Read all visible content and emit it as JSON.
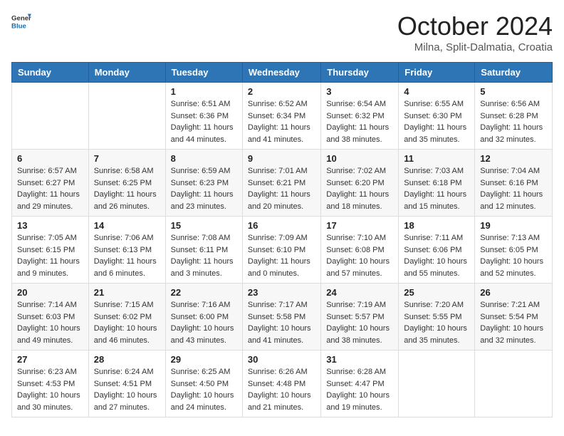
{
  "logo": {
    "general": "General",
    "blue": "Blue"
  },
  "header": {
    "month": "October 2024",
    "location": "Milna, Split-Dalmatia, Croatia"
  },
  "weekdays": [
    "Sunday",
    "Monday",
    "Tuesday",
    "Wednesday",
    "Thursday",
    "Friday",
    "Saturday"
  ],
  "weeks": [
    [
      {
        "day": "",
        "sunrise": "",
        "sunset": "",
        "daylight": ""
      },
      {
        "day": "",
        "sunrise": "",
        "sunset": "",
        "daylight": ""
      },
      {
        "day": "1",
        "sunrise": "Sunrise: 6:51 AM",
        "sunset": "Sunset: 6:36 PM",
        "daylight": "Daylight: 11 hours and 44 minutes."
      },
      {
        "day": "2",
        "sunrise": "Sunrise: 6:52 AM",
        "sunset": "Sunset: 6:34 PM",
        "daylight": "Daylight: 11 hours and 41 minutes."
      },
      {
        "day": "3",
        "sunrise": "Sunrise: 6:54 AM",
        "sunset": "Sunset: 6:32 PM",
        "daylight": "Daylight: 11 hours and 38 minutes."
      },
      {
        "day": "4",
        "sunrise": "Sunrise: 6:55 AM",
        "sunset": "Sunset: 6:30 PM",
        "daylight": "Daylight: 11 hours and 35 minutes."
      },
      {
        "day": "5",
        "sunrise": "Sunrise: 6:56 AM",
        "sunset": "Sunset: 6:28 PM",
        "daylight": "Daylight: 11 hours and 32 minutes."
      }
    ],
    [
      {
        "day": "6",
        "sunrise": "Sunrise: 6:57 AM",
        "sunset": "Sunset: 6:27 PM",
        "daylight": "Daylight: 11 hours and 29 minutes."
      },
      {
        "day": "7",
        "sunrise": "Sunrise: 6:58 AM",
        "sunset": "Sunset: 6:25 PM",
        "daylight": "Daylight: 11 hours and 26 minutes."
      },
      {
        "day": "8",
        "sunrise": "Sunrise: 6:59 AM",
        "sunset": "Sunset: 6:23 PM",
        "daylight": "Daylight: 11 hours and 23 minutes."
      },
      {
        "day": "9",
        "sunrise": "Sunrise: 7:01 AM",
        "sunset": "Sunset: 6:21 PM",
        "daylight": "Daylight: 11 hours and 20 minutes."
      },
      {
        "day": "10",
        "sunrise": "Sunrise: 7:02 AM",
        "sunset": "Sunset: 6:20 PM",
        "daylight": "Daylight: 11 hours and 18 minutes."
      },
      {
        "day": "11",
        "sunrise": "Sunrise: 7:03 AM",
        "sunset": "Sunset: 6:18 PM",
        "daylight": "Daylight: 11 hours and 15 minutes."
      },
      {
        "day": "12",
        "sunrise": "Sunrise: 7:04 AM",
        "sunset": "Sunset: 6:16 PM",
        "daylight": "Daylight: 11 hours and 12 minutes."
      }
    ],
    [
      {
        "day": "13",
        "sunrise": "Sunrise: 7:05 AM",
        "sunset": "Sunset: 6:15 PM",
        "daylight": "Daylight: 11 hours and 9 minutes."
      },
      {
        "day": "14",
        "sunrise": "Sunrise: 7:06 AM",
        "sunset": "Sunset: 6:13 PM",
        "daylight": "Daylight: 11 hours and 6 minutes."
      },
      {
        "day": "15",
        "sunrise": "Sunrise: 7:08 AM",
        "sunset": "Sunset: 6:11 PM",
        "daylight": "Daylight: 11 hours and 3 minutes."
      },
      {
        "day": "16",
        "sunrise": "Sunrise: 7:09 AM",
        "sunset": "Sunset: 6:10 PM",
        "daylight": "Daylight: 11 hours and 0 minutes."
      },
      {
        "day": "17",
        "sunrise": "Sunrise: 7:10 AM",
        "sunset": "Sunset: 6:08 PM",
        "daylight": "Daylight: 10 hours and 57 minutes."
      },
      {
        "day": "18",
        "sunrise": "Sunrise: 7:11 AM",
        "sunset": "Sunset: 6:06 PM",
        "daylight": "Daylight: 10 hours and 55 minutes."
      },
      {
        "day": "19",
        "sunrise": "Sunrise: 7:13 AM",
        "sunset": "Sunset: 6:05 PM",
        "daylight": "Daylight: 10 hours and 52 minutes."
      }
    ],
    [
      {
        "day": "20",
        "sunrise": "Sunrise: 7:14 AM",
        "sunset": "Sunset: 6:03 PM",
        "daylight": "Daylight: 10 hours and 49 minutes."
      },
      {
        "day": "21",
        "sunrise": "Sunrise: 7:15 AM",
        "sunset": "Sunset: 6:02 PM",
        "daylight": "Daylight: 10 hours and 46 minutes."
      },
      {
        "day": "22",
        "sunrise": "Sunrise: 7:16 AM",
        "sunset": "Sunset: 6:00 PM",
        "daylight": "Daylight: 10 hours and 43 minutes."
      },
      {
        "day": "23",
        "sunrise": "Sunrise: 7:17 AM",
        "sunset": "Sunset: 5:58 PM",
        "daylight": "Daylight: 10 hours and 41 minutes."
      },
      {
        "day": "24",
        "sunrise": "Sunrise: 7:19 AM",
        "sunset": "Sunset: 5:57 PM",
        "daylight": "Daylight: 10 hours and 38 minutes."
      },
      {
        "day": "25",
        "sunrise": "Sunrise: 7:20 AM",
        "sunset": "Sunset: 5:55 PM",
        "daylight": "Daylight: 10 hours and 35 minutes."
      },
      {
        "day": "26",
        "sunrise": "Sunrise: 7:21 AM",
        "sunset": "Sunset: 5:54 PM",
        "daylight": "Daylight: 10 hours and 32 minutes."
      }
    ],
    [
      {
        "day": "27",
        "sunrise": "Sunrise: 6:23 AM",
        "sunset": "Sunset: 4:53 PM",
        "daylight": "Daylight: 10 hours and 30 minutes."
      },
      {
        "day": "28",
        "sunrise": "Sunrise: 6:24 AM",
        "sunset": "Sunset: 4:51 PM",
        "daylight": "Daylight: 10 hours and 27 minutes."
      },
      {
        "day": "29",
        "sunrise": "Sunrise: 6:25 AM",
        "sunset": "Sunset: 4:50 PM",
        "daylight": "Daylight: 10 hours and 24 minutes."
      },
      {
        "day": "30",
        "sunrise": "Sunrise: 6:26 AM",
        "sunset": "Sunset: 4:48 PM",
        "daylight": "Daylight: 10 hours and 21 minutes."
      },
      {
        "day": "31",
        "sunrise": "Sunrise: 6:28 AM",
        "sunset": "Sunset: 4:47 PM",
        "daylight": "Daylight: 10 hours and 19 minutes."
      },
      {
        "day": "",
        "sunrise": "",
        "sunset": "",
        "daylight": ""
      },
      {
        "day": "",
        "sunrise": "",
        "sunset": "",
        "daylight": ""
      }
    ]
  ]
}
